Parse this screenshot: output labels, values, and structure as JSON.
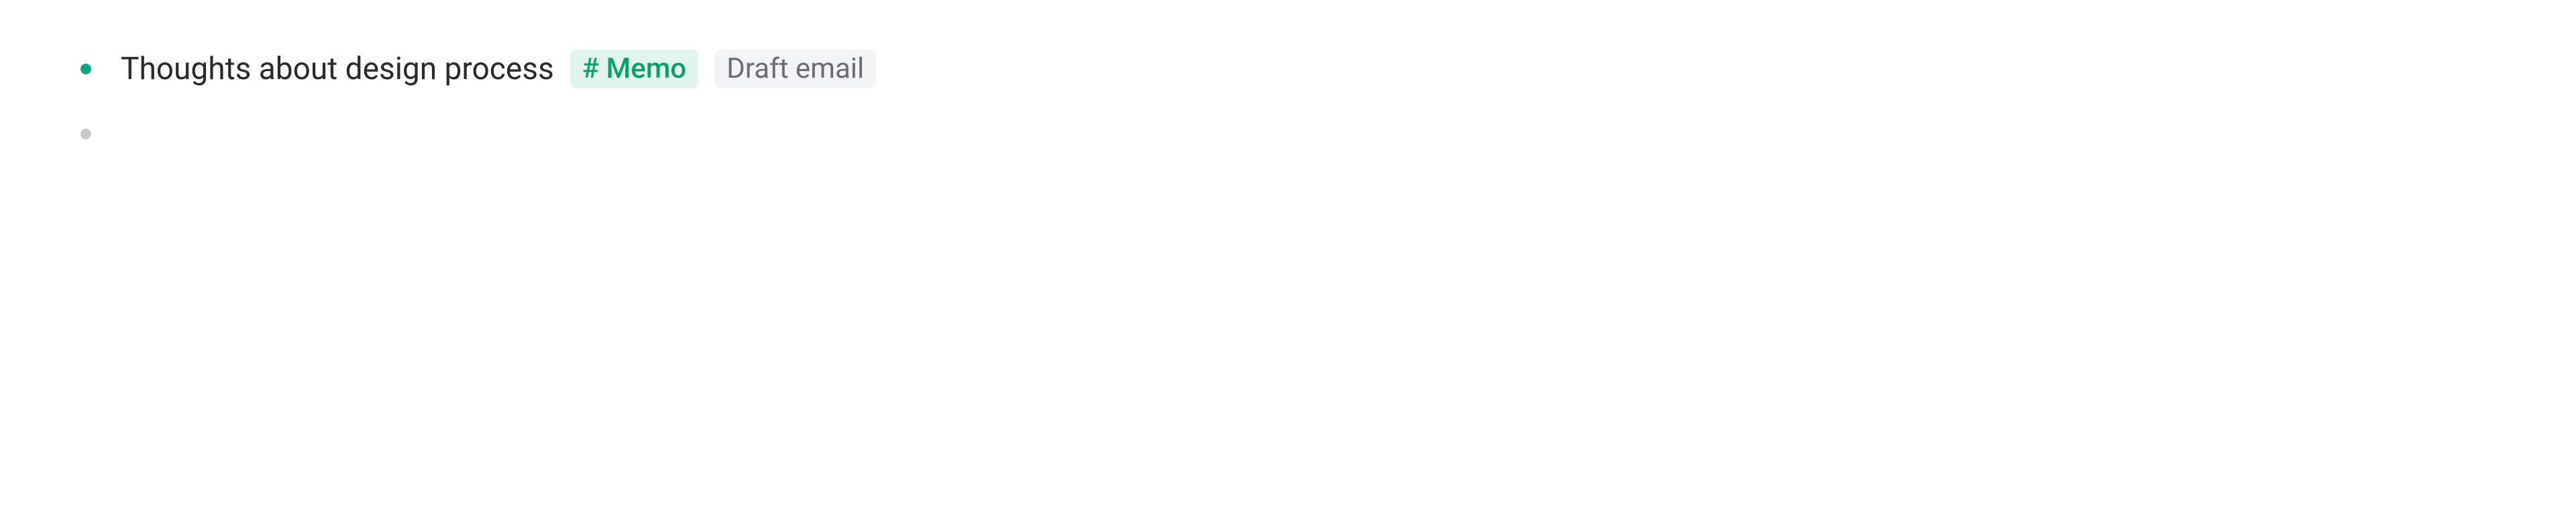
{
  "items": [
    {
      "bullet_color": "green",
      "title": "Thoughts about design process",
      "tags": [
        {
          "kind": "memo",
          "label": "# Memo"
        },
        {
          "kind": "draft",
          "label": "Draft email"
        }
      ]
    },
    {
      "bullet_color": "grey",
      "title": "",
      "tags": []
    }
  ]
}
